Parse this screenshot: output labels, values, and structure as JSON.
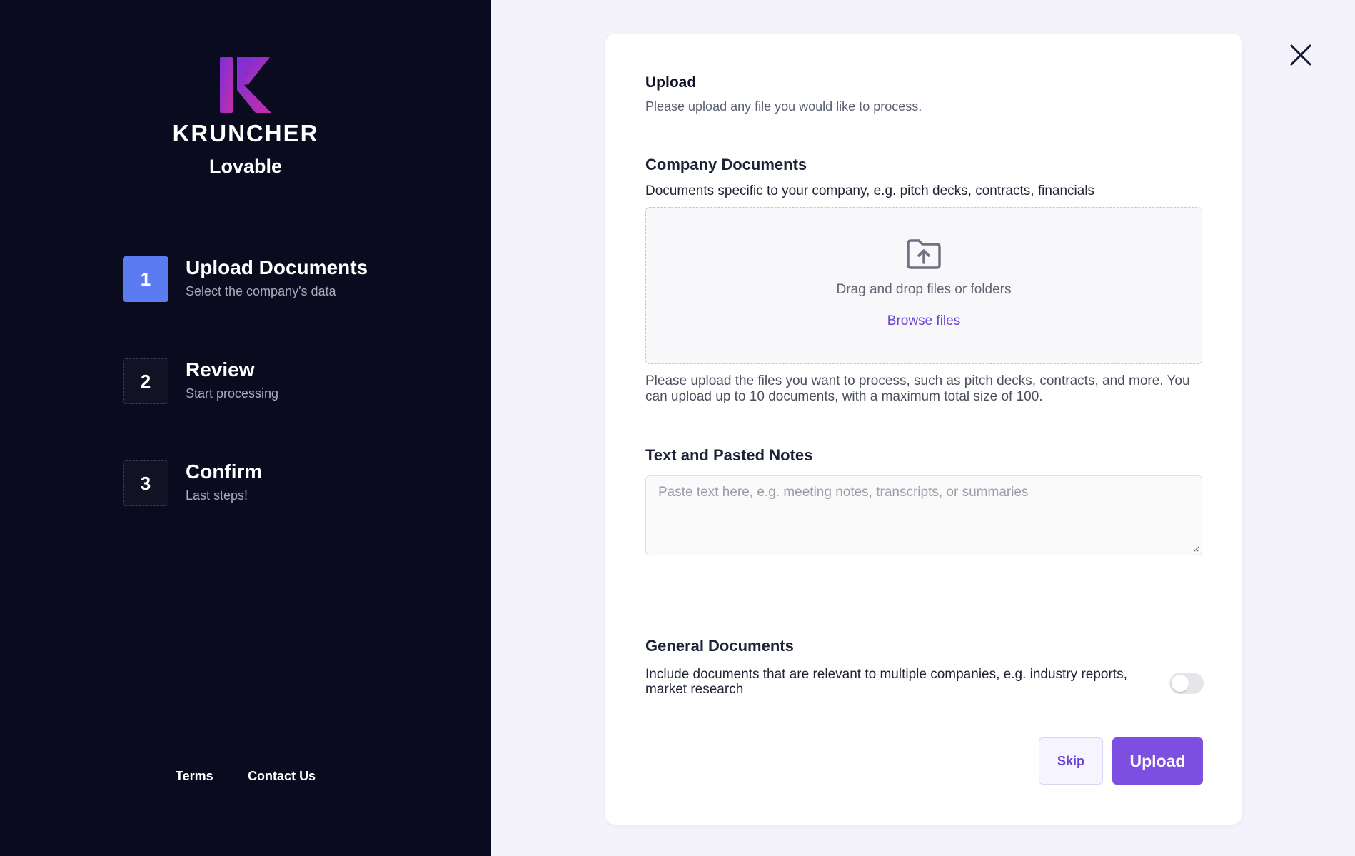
{
  "sidebar": {
    "brand": "KRUNCHER",
    "workspace": "Lovable",
    "steps": [
      {
        "number": "1",
        "title": "Upload Documents",
        "subtitle": "Select the company's data",
        "active": true
      },
      {
        "number": "2",
        "title": "Review",
        "subtitle": "Start processing",
        "active": false
      },
      {
        "number": "3",
        "title": "Confirm",
        "subtitle": "Last steps!",
        "active": false
      }
    ],
    "footer": {
      "terms": "Terms",
      "contact": "Contact Us"
    }
  },
  "main": {
    "heading": "Upload",
    "subheading": "Please upload any file you would like to process.",
    "company_documents": {
      "title": "Company Documents",
      "description": "Documents specific to your company, e.g. pitch decks, contracts, financials",
      "dropzone_text": "Drag and drop files or folders",
      "browse_label": "Browse files",
      "help_text": "Please upload the files you want to process, such as pitch decks, contracts, and more. You can upload up to 10 documents, with a maximum total size of 100."
    },
    "notes": {
      "title": "Text and Pasted Notes",
      "placeholder": "Paste text here, e.g. meeting notes, transcripts, or summaries",
      "value": ""
    },
    "general_documents": {
      "title": "General Documents",
      "description": "Include documents that are relevant to multiple companies, e.g. industry reports, market research",
      "toggle_on": false
    },
    "actions": {
      "skip": "Skip",
      "upload": "Upload"
    }
  },
  "colors": {
    "sidebar_bg": "#0a0b1e",
    "accent_purple": "#7c4fe0",
    "step_active": "#5b7cf0",
    "page_bg": "#f4f3fb"
  },
  "icons": {
    "close": "close-icon",
    "folder_upload": "folder-upload-icon",
    "logo": "kruncher-logo-icon"
  }
}
